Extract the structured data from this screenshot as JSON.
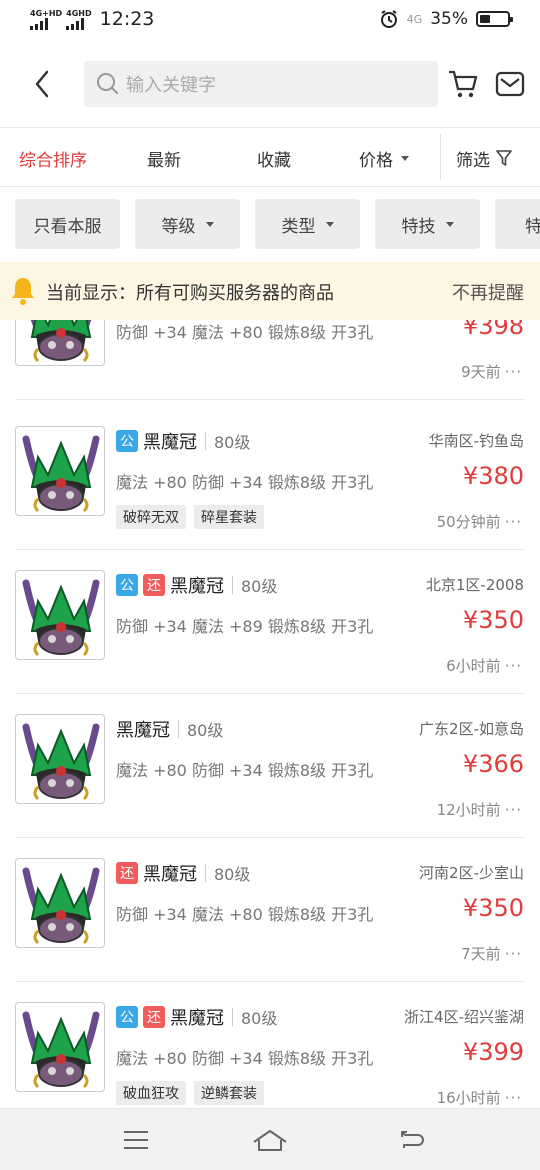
{
  "status": {
    "net1": "4G+HD",
    "net2": "4GHD",
    "time": "12:23",
    "net3": "4G",
    "battery": "35%"
  },
  "search": {
    "placeholder": "输入关键字"
  },
  "sort": {
    "items": [
      "综合排序",
      "最新",
      "收藏",
      "价格"
    ],
    "filter": "筛选"
  },
  "chips": [
    "只看本服",
    "等级",
    "类型",
    "特技",
    "特"
  ],
  "notice": {
    "text": "当前显示：所有可购买服务器的商品",
    "dismiss": "不再提醒"
  },
  "items": [
    {
      "badges": [],
      "name": "",
      "level": "",
      "server": "",
      "attrs": "防御 +34 魔法 +80 锻炼8级 开3孔",
      "price": "¥398",
      "tags": [],
      "time": "9天前"
    },
    {
      "badges": [
        "公"
      ],
      "name": "黑魔冠",
      "level": "80级",
      "server": "华南区-钓鱼岛",
      "attrs": "魔法 +80 防御 +34 锻炼8级 开3孔",
      "price": "¥380",
      "tags": [
        "破碎无双",
        "碎星套装"
      ],
      "time": "50分钟前"
    },
    {
      "badges": [
        "公",
        "还"
      ],
      "name": "黑魔冠",
      "level": "80级",
      "server": "北京1区-2008",
      "attrs": "防御 +34 魔法 +89 锻炼8级 开3孔",
      "price": "¥350",
      "tags": [],
      "time": "6小时前"
    },
    {
      "badges": [],
      "name": "黑魔冠",
      "level": "80级",
      "server": "广东2区-如意岛",
      "attrs": "魔法 +80 防御 +34 锻炼8级 开3孔",
      "price": "¥366",
      "tags": [],
      "time": "12小时前"
    },
    {
      "badges": [
        "还"
      ],
      "name": "黑魔冠",
      "level": "80级",
      "server": "河南2区-少室山",
      "attrs": "防御 +34 魔法 +80 锻炼8级 开3孔",
      "price": "¥350",
      "tags": [],
      "time": "7天前"
    },
    {
      "badges": [
        "公",
        "还"
      ],
      "name": "黑魔冠",
      "level": "80级",
      "server": "浙江4区-绍兴鉴湖",
      "attrs": "魔法 +80 防御 +34 锻炼8级 开3孔",
      "price": "¥399",
      "tags": [
        "破血狂攻",
        "逆鳞套装"
      ],
      "time": "16小时前"
    }
  ],
  "more_glyph": "···"
}
